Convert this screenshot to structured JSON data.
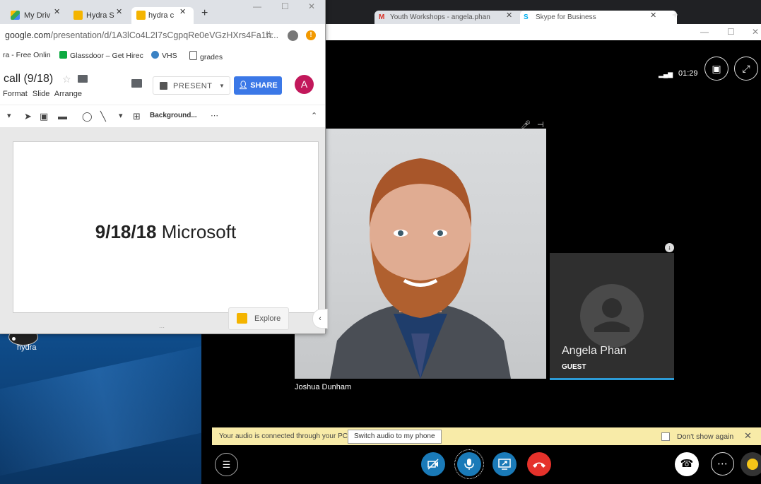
{
  "desktop": {
    "icon_label": "hydra"
  },
  "chrome_back": {
    "tabs": [
      {
        "label": "Youth Workshops - angela.phan",
        "icon": "gmail-icon"
      },
      {
        "label": "Skype for Business",
        "icon": "skype-icon"
      }
    ],
    "new_tab": "+"
  },
  "chrome_front": {
    "tabs": [
      {
        "label": "My Driv",
        "icon": "google-drive-icon"
      },
      {
        "label": "Hydra S",
        "icon": "slides-icon"
      },
      {
        "label": "hydra c",
        "icon": "slides-icon"
      }
    ],
    "new_tab": "+",
    "url_main": "google.com",
    "url_rest": "/presentation/d/1A3lCo4L2I7sCgpqRe0eVGzHXrs4Fa1h...",
    "bookmarks": [
      {
        "label": "ra - Free Onlin"
      },
      {
        "label": "Glassdoor – Get Hirec"
      },
      {
        "label": "VHS"
      },
      {
        "label": "grades"
      }
    ],
    "doc_title": "call (9/18)",
    "menu": "Format  Slide  Arrange",
    "present_label": "PRESENT",
    "share_label": "SHARE",
    "avatar_letter": "A",
    "toolbar_bg_label": "Background...",
    "toolbar_more": "⋯",
    "slide": {
      "date_text": "9/18/18",
      "company_text": "Microsoft"
    },
    "explore_label": "Explore",
    "colors": {
      "share": "#3b78e7",
      "avatar": "#c2185b",
      "explore": "#f4b400"
    }
  },
  "call": {
    "timer": "01:29",
    "main_participant": "Joshua Dunham",
    "guest_name": "Angela Phan",
    "guest_role": "GUEST",
    "notice_text": "Your audio is connected through your PC.",
    "switch_audio_label": "Switch audio to my phone",
    "dont_show_label": "Don't show again",
    "colors": {
      "control_blue": "#1a7ab8",
      "hangup": "#e5322b",
      "notice_bg": "#f8eba8",
      "active_bar": "#2c9bd6"
    }
  }
}
